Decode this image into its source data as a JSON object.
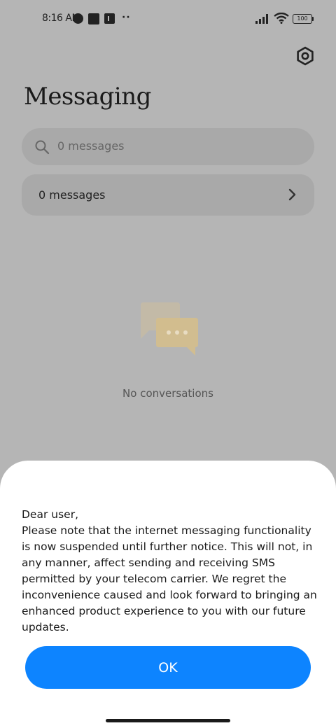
{
  "status_bar": {
    "time": "8:16 AM",
    "battery_level": "100"
  },
  "header": {
    "title": "Messaging"
  },
  "search": {
    "placeholder": "0 messages"
  },
  "messages_row": {
    "label": "0 messages"
  },
  "empty_state": {
    "text": "No conversations"
  },
  "dialog": {
    "greeting": "Dear user,",
    "message": "Please note that the internet messaging functionality is now suspended until further notice. This will not, in any manner, affect sending and receiving SMS permitted by your telecom carrier. We regret the inconvenience caused and look forward to bringing an enhanced product experience to you with our future updates.",
    "ok_label": "OK"
  },
  "icons": {
    "settings": "gear-icon",
    "search": "search-icon",
    "chevron": "chevron-right-icon",
    "empty": "chat-bubbles-icon"
  },
  "colors": {
    "accent": "#0d84ff",
    "overlay_background": "#b5b5b5",
    "sheet_background": "#ffffff"
  }
}
